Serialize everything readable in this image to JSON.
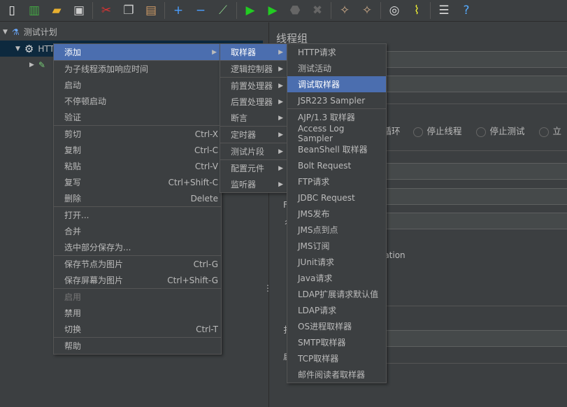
{
  "toolbar": {
    "icons": [
      "new-icon",
      "templates-icon",
      "open-icon",
      "save-icon",
      "cut-icon",
      "copy-icon",
      "paste-icon",
      "expand-icon",
      "collapse-icon",
      "toggle-icon",
      "start-icon",
      "start-no-pause-icon",
      "stop-icon",
      "shutdown-icon",
      "clear-icon",
      "clear-all-icon",
      "search-icon",
      "reset-search-icon",
      "function-helper-icon",
      "help-icon"
    ]
  },
  "tree": {
    "root": "测试计划",
    "thread_group": "HTTP",
    "child_icon": "sampler-icon"
  },
  "panel": {
    "title": "线程组",
    "partial_sep_text": "E",
    "radio_partial": "程循环",
    "radios": [
      "停止线程",
      "停止测试",
      "立"
    ],
    "iteration_partial": "eration",
    "labels_partial": [
      "F",
      "彳",
      "扌",
      "启"
    ]
  },
  "context_menu": {
    "items": [
      {
        "label": "添加",
        "submenu": true,
        "selected": true
      },
      {
        "sep": true
      },
      {
        "label": "为子线程添加响应时间"
      },
      {
        "label": "启动"
      },
      {
        "label": "不停顿启动"
      },
      {
        "label": "验证"
      },
      {
        "sep": true
      },
      {
        "label": "剪切",
        "shortcut": "Ctrl-X"
      },
      {
        "label": "复制",
        "shortcut": "Ctrl-C"
      },
      {
        "label": "粘贴",
        "shortcut": "Ctrl-V"
      },
      {
        "label": "复写",
        "shortcut": "Ctrl+Shift-C"
      },
      {
        "label": "删除",
        "shortcut": "Delete"
      },
      {
        "sep": true
      },
      {
        "label": "打开..."
      },
      {
        "label": "合并"
      },
      {
        "label": "选中部分保存为..."
      },
      {
        "sep": true
      },
      {
        "label": "保存节点为图片",
        "shortcut": "Ctrl-G"
      },
      {
        "label": "保存屏幕为图片",
        "shortcut": "Ctrl+Shift-G"
      },
      {
        "sep": true
      },
      {
        "label": "启用",
        "disabled": true
      },
      {
        "label": "禁用"
      },
      {
        "label": "切换",
        "shortcut": "Ctrl-T"
      },
      {
        "sep": true
      },
      {
        "label": "帮助"
      }
    ]
  },
  "add_menu": {
    "items": [
      {
        "label": "取样器",
        "selected": true
      },
      {
        "sep": true
      },
      {
        "label": "逻辑控制器"
      },
      {
        "sep": true
      },
      {
        "label": "前置处理器"
      },
      {
        "label": "后置处理器"
      },
      {
        "label": "断言"
      },
      {
        "sep": true
      },
      {
        "label": "定时器"
      },
      {
        "sep": true
      },
      {
        "label": "测试片段"
      },
      {
        "sep": true
      },
      {
        "label": "配置元件"
      },
      {
        "label": "监听器"
      }
    ]
  },
  "sampler_menu": {
    "items": [
      {
        "label": "HTTP请求"
      },
      {
        "label": "测试活动"
      },
      {
        "label": "调试取样器",
        "selected": true
      },
      {
        "label": "JSR223 Sampler"
      },
      {
        "sep": true
      },
      {
        "label": "AJP/1.3 取样器"
      },
      {
        "label": "Access Log Sampler"
      },
      {
        "label": "BeanShell 取样器"
      },
      {
        "label": "Bolt Request"
      },
      {
        "label": "FTP请求"
      },
      {
        "label": "JDBC Request"
      },
      {
        "label": "JMS发布"
      },
      {
        "label": "JMS点到点"
      },
      {
        "label": "JMS订阅"
      },
      {
        "label": "JUnit请求"
      },
      {
        "label": "Java请求"
      },
      {
        "label": "LDAP扩展请求默认值"
      },
      {
        "label": "LDAP请求"
      },
      {
        "label": "OS进程取样器"
      },
      {
        "label": "SMTP取样器"
      },
      {
        "label": "TCP取样器"
      },
      {
        "label": "邮件阅读者取样器"
      }
    ]
  },
  "colors": {
    "background": "#3c3f41",
    "selection": "#4b6eaf",
    "tree_selection": "#0d293e"
  }
}
